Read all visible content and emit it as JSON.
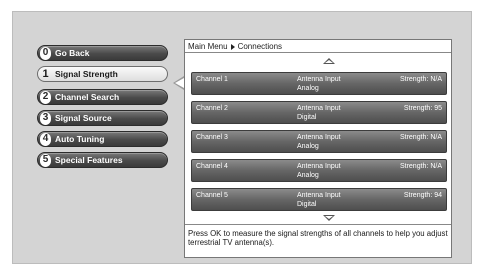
{
  "menu": {
    "items": [
      {
        "number": "0",
        "label": "Go Back"
      },
      {
        "number": "1",
        "label": "Signal Strength"
      },
      {
        "number": "2",
        "label": "Channel Search"
      },
      {
        "number": "3",
        "label": "Signal Source"
      },
      {
        "number": "4",
        "label": "Auto Tuning"
      },
      {
        "number": "5",
        "label": "Special Features"
      }
    ]
  },
  "breadcrumb": {
    "parent": "Main Menu",
    "current": "Connections"
  },
  "channels": [
    {
      "name": "Channel 1",
      "input": "Antenna Input",
      "type": "Analog",
      "strength": "Strength: N/A"
    },
    {
      "name": "Channel 2",
      "input": "Antenna Input",
      "type": "Digital",
      "strength": "Strength: 95"
    },
    {
      "name": "Channel 3",
      "input": "Antenna Input",
      "type": "Analog",
      "strength": "Strength: N/A"
    },
    {
      "name": "Channel 4",
      "input": "Antenna Input",
      "type": "Analog",
      "strength": "Strength: N/A"
    },
    {
      "name": "Channel 5",
      "input": "Antenna Input",
      "type": "Digital",
      "strength": "Strength: 94"
    }
  ],
  "help_text": "Press OK to measure the signal strengths of all channels to help you adjust terrestrial TV antenna(s)."
}
